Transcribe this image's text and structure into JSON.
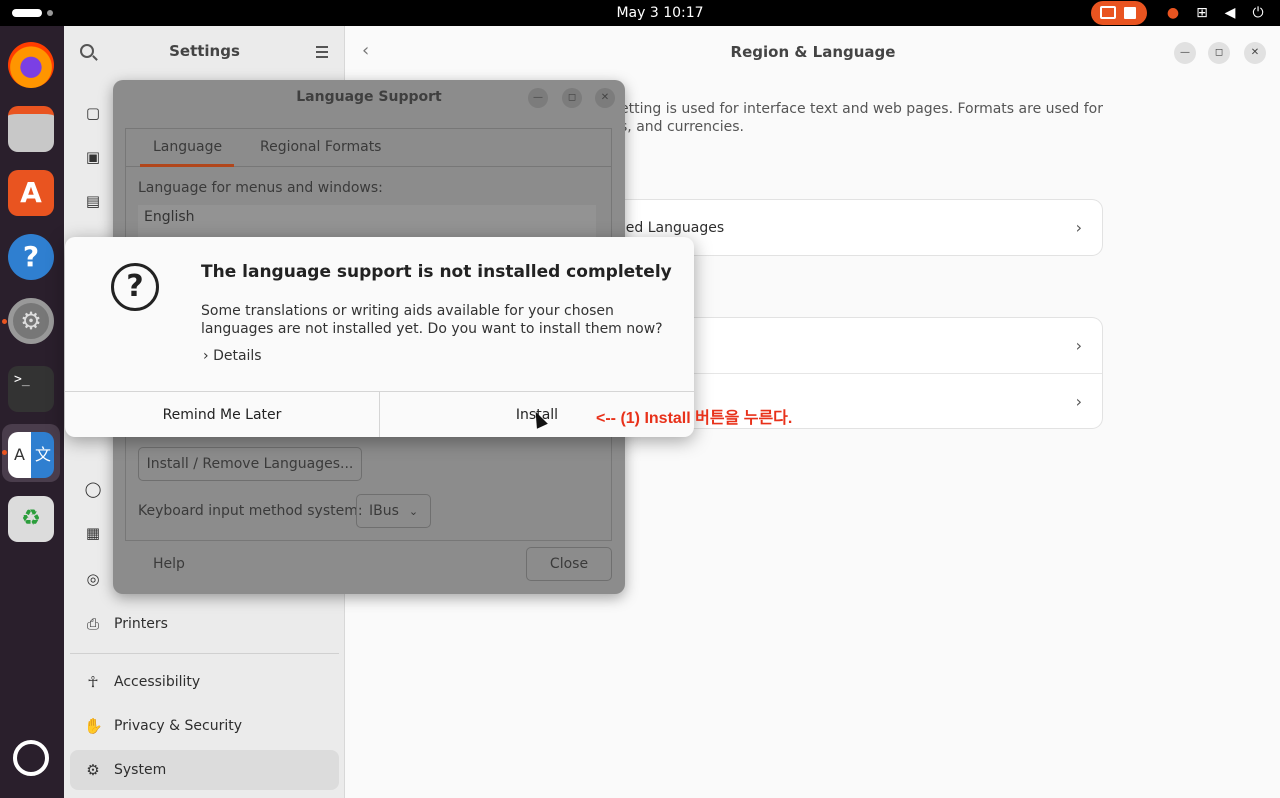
{
  "topbar": {
    "datetime": "May 3  10:17"
  },
  "colors": {
    "accent": "#e95420",
    "annotation": "#e8311a"
  },
  "settings": {
    "sidebar_title": "Settings",
    "sidebar_items": [
      "Printers",
      "Accessibility",
      "Privacy & Security",
      "System"
    ],
    "active_item": "System",
    "page_title": "Region & Language",
    "description_line1": "etting is used for interface text and web pages. Formats are used for",
    "description_line2": "s, and currencies.",
    "installed_languages_label": "lled Languages"
  },
  "language_support": {
    "title": "Language Support",
    "tabs": [
      "Language",
      "Regional Formats"
    ],
    "menus_label": "Language for menus and windows:",
    "languages": [
      "English"
    ],
    "install_remove_button": "Install / Remove Languages...",
    "keyboard_label": "Keyboard input method system:",
    "keyboard_value": "IBus",
    "help_button": "Help",
    "close_button": "Close"
  },
  "alert": {
    "title": "The language support is not installed completely",
    "body": "Some translations or writing aids available for your chosen languages are not installed yet. Do you want to install them now?",
    "details": "Details",
    "remind_button": "Remind Me Later",
    "install_button": "Install"
  },
  "annotation": "<-- (1) Install 버튼을 누른다."
}
